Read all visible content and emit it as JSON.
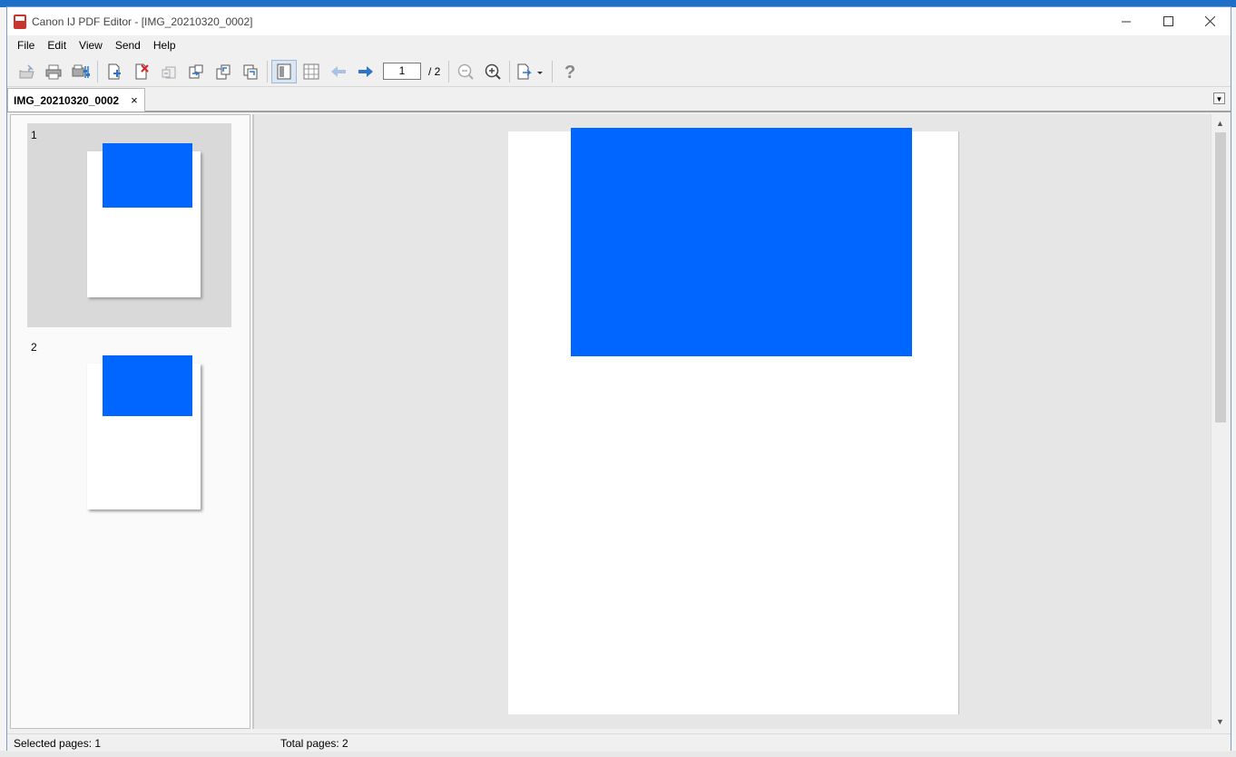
{
  "window": {
    "title": "Canon IJ PDF Editor - [IMG_20210320_0002]",
    "controls": [
      "minimize",
      "maximize",
      "close"
    ]
  },
  "menu": {
    "items": [
      "File",
      "Edit",
      "View",
      "Send",
      "Help"
    ]
  },
  "toolbar": {
    "buttons": [
      "open-icon",
      "print-icon",
      "settings-icon",
      "add-page-icon",
      "delete-page-icon",
      "rotate-left-icon",
      "rotate-right-icon",
      "move-page-left-icon",
      "move-page-right-icon",
      "page-view-icon",
      "thumbnail-view-icon",
      "previous-page-icon",
      "next-page-icon",
      "zoom-out-icon",
      "zoom-in-icon",
      "export-icon",
      "help-icon"
    ],
    "current_page": "1",
    "total_pages": "/ 2"
  },
  "tabs": [
    {
      "label": "IMG_20210320_0002",
      "close": "×"
    }
  ],
  "thumbnails": [
    {
      "number": "1",
      "selected": true
    },
    {
      "number": "2",
      "selected": false
    }
  ],
  "status": {
    "selected_pages": "Selected pages: 1",
    "total_pages": "Total pages: 2"
  },
  "colors": {
    "image_blue": "#0066ff",
    "selection_gray": "#d9d9d9",
    "view_background": "#e6e6e6"
  }
}
